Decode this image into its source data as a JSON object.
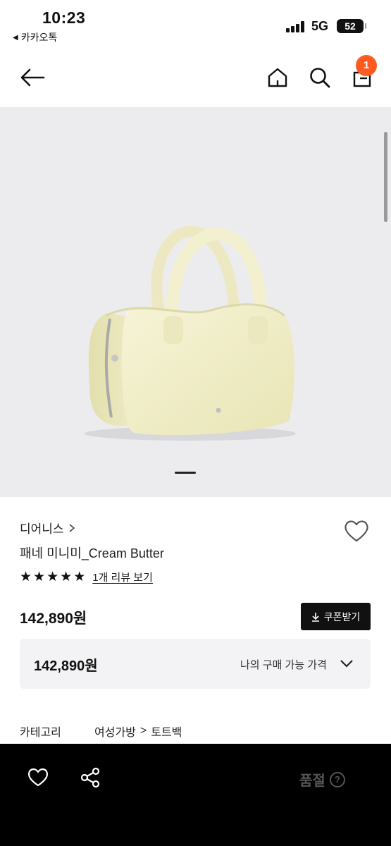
{
  "status_bar": {
    "time": "10:23",
    "back_app": "카카오톡",
    "network": "5G",
    "battery": "52"
  },
  "nav": {
    "cart_count": "1"
  },
  "product": {
    "brand": "디어니스",
    "title": "패네 미니미_Cream Butter",
    "rating_stars": 5,
    "review_link": "1개 리뷰 보기",
    "price": "142,890원",
    "coupon_button": "쿠폰받기",
    "purchase_price": "142,890원",
    "purchase_price_label": "나의 구매 가능 가격",
    "image_alt": "bag"
  },
  "category": {
    "label": "카테고리",
    "path": [
      "여성가방",
      "토트백"
    ]
  },
  "bottom_bar": {
    "soldout_label": "품절",
    "help": "?"
  },
  "colors": {
    "accent_badge": "#ff5a1f",
    "bag_color": "#f1efc6"
  }
}
